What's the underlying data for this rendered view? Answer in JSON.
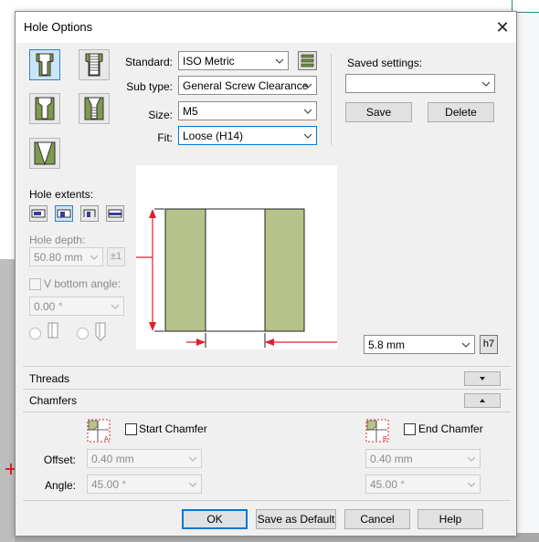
{
  "dialog": {
    "title": "Hole Options",
    "close_icon": "close-icon"
  },
  "hole_types": [
    {
      "name": "counterbore-hole-icon",
      "selected": true
    },
    {
      "name": "tapped-hole-icon",
      "selected": false
    },
    {
      "name": "countersink-hole-icon",
      "selected": false
    },
    {
      "name": "tapped-countersink-hole-icon",
      "selected": false
    },
    {
      "name": "cone-bottom-hole-icon",
      "selected": false
    }
  ],
  "standard": {
    "label": "Standard:",
    "value": "ISO Metric"
  },
  "subtype": {
    "label": "Sub type:",
    "value": "General Screw Clearance"
  },
  "size": {
    "label": "Size:",
    "value": "M5"
  },
  "fit": {
    "label": "Fit:",
    "value": "Loose (H14)"
  },
  "saved_settings": {
    "label": "Saved settings:",
    "value": "",
    "save_label": "Save",
    "delete_label": "Delete"
  },
  "hole_extents": {
    "label": "Hole extents:"
  },
  "hole_depth": {
    "label": "Hole depth:",
    "value": "50.80 mm",
    "tol_label": "±1"
  },
  "v_bottom": {
    "label": "V bottom angle:",
    "value": "0.00 °"
  },
  "diameter": {
    "value": "5.8 mm",
    "tol_label": "h7"
  },
  "threads": {
    "label": "Threads"
  },
  "chamfers": {
    "label": "Chamfers"
  },
  "start_chamfer": {
    "label": "Start Chamfer",
    "offset": "0.40 mm",
    "angle": "45.00 °"
  },
  "end_chamfer": {
    "label": "End Chamfer",
    "offset": "0.40 mm",
    "angle": "45.00 °"
  },
  "offset_label": "Offset:",
  "angle_label": "Angle:",
  "footer": {
    "ok": "OK",
    "save_default": "Save as Default",
    "cancel": "Cancel",
    "help": "Help"
  },
  "colors": {
    "accent": "#0078d7",
    "hole_wall": "#b5c28a",
    "dimension": "#e0202a"
  }
}
